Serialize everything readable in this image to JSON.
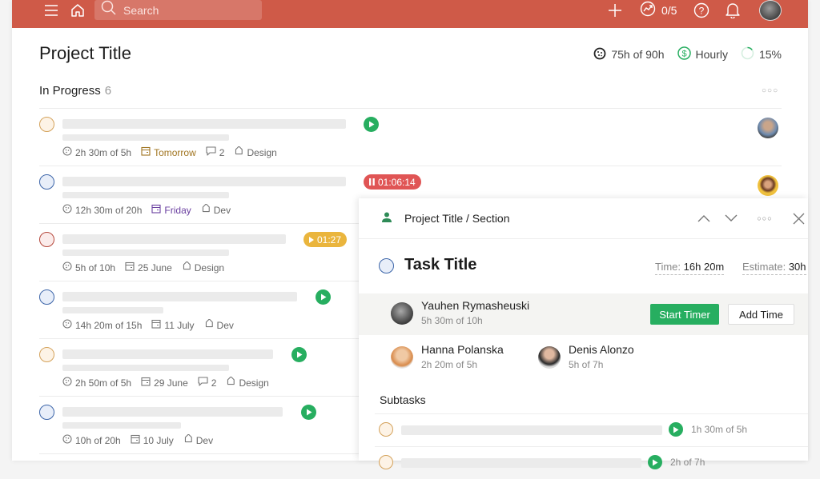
{
  "topbar": {
    "search_placeholder": "Search",
    "goals_count": "0/5",
    "icons": [
      "menu-icon",
      "home-icon",
      "search-icon",
      "plus-icon",
      "trend-icon",
      "help-icon",
      "bell-icon",
      "avatar"
    ]
  },
  "header": {
    "title": "Project Title",
    "hours": "75h of 90h",
    "billing": "Hourly",
    "progress": "15%",
    "progress_fraction": 0.15
  },
  "section": {
    "title": "In Progress",
    "count": "6"
  },
  "tasks": [
    {
      "status_color": "#d4a25b",
      "time": "2h 30m of 5h",
      "date": "Tomorrow",
      "date_color": "#a0741f",
      "comments": "2",
      "tag": "Design",
      "timer": {
        "type": "play"
      },
      "avatar": "man"
    },
    {
      "status_color": "#3b64a8",
      "time": "12h 30m of 20h",
      "date": "Friday",
      "date_color": "#6a3fa0",
      "comments": null,
      "tag": "Dev",
      "timer": {
        "type": "running",
        "label": "01:06:14",
        "color": "#e05555"
      },
      "avatar": "woman"
    },
    {
      "status_color": "#b5473b",
      "time": "5h of 10h",
      "date": "25 June",
      "date_color": "#666666",
      "comments": null,
      "tag": "Design",
      "timer": {
        "type": "paused",
        "label": "01:27",
        "color": "#eab53d"
      },
      "avatar": null
    },
    {
      "status_color": "#3b64a8",
      "time": "14h 20m of 15h",
      "date": "11 July",
      "date_color": "#666666",
      "comments": null,
      "tag": "Dev",
      "timer": {
        "type": "play"
      },
      "avatar": null
    },
    {
      "status_color": "#d4a25b",
      "time": "2h 50m of 5h",
      "date": "29 June",
      "date_color": "#666666",
      "comments": "2",
      "tag": "Design",
      "timer": {
        "type": "play"
      },
      "avatar": null
    },
    {
      "status_color": "#3b64a8",
      "time": "10h of 20h",
      "date": "10 July",
      "date_color": "#666666",
      "comments": null,
      "tag": "Dev",
      "timer": {
        "type": "play"
      },
      "avatar": null
    }
  ],
  "panel": {
    "breadcrumb": "Project Title / Section",
    "task_title": "Task Title",
    "time_label": "Time:",
    "time_value": "16h 20m",
    "estimate_label": "Estimate:",
    "estimate_value": "30h",
    "main_assignee": {
      "name": "Yauhen Rymasheuski",
      "time": "5h 30m of 10h"
    },
    "start_timer": "Start Timer",
    "add_time": "Add Time",
    "assignees": [
      {
        "name": "Hanna Polanska",
        "time": "2h 20m of 5h"
      },
      {
        "name": "Denis Alonzo",
        "time": "5h of 7h"
      }
    ],
    "subtasks_title": "Subtasks",
    "subtasks": [
      {
        "time": "1h 30m of 5h"
      },
      {
        "time": "2h of 7h"
      }
    ]
  },
  "colors": {
    "brand": "#cf5a48",
    "green": "#27ae60"
  }
}
